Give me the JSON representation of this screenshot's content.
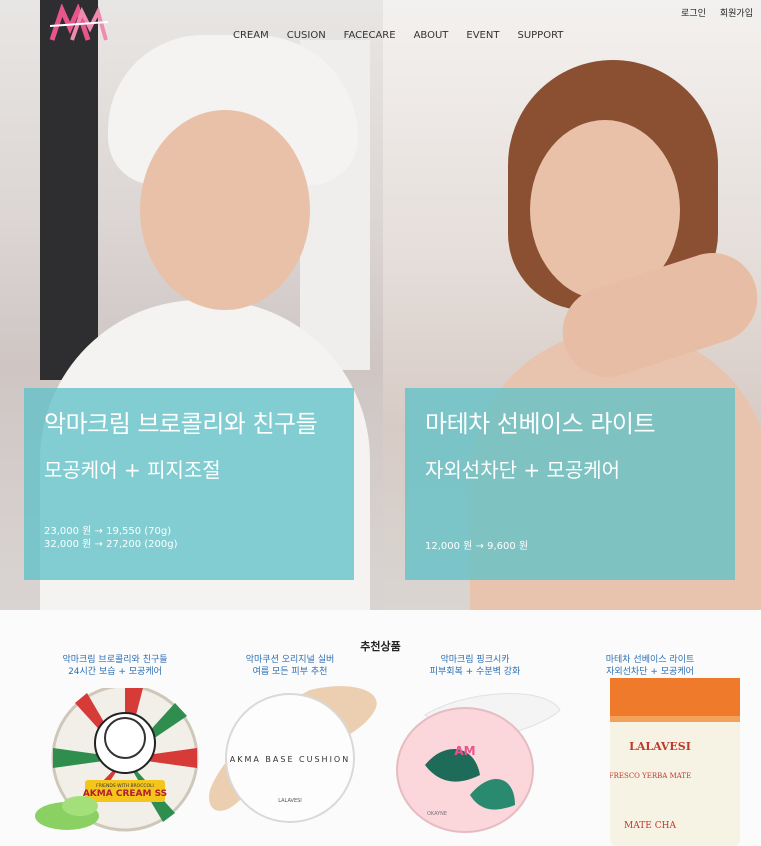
{
  "brand": {
    "logo_text": "AM",
    "accent": "#e8558c",
    "card_color": "#60c2c8"
  },
  "utility_nav": [
    {
      "label": "로그인"
    },
    {
      "label": "회원가입"
    }
  ],
  "main_nav": [
    {
      "label": "CREAM"
    },
    {
      "label": "CUSION"
    },
    {
      "label": "FACECARE"
    },
    {
      "label": "ABOUT"
    },
    {
      "label": "EVENT"
    },
    {
      "label": "SUPPORT"
    }
  ],
  "hero": {
    "left": {
      "title": "악마크림 브로콜리와 친구들",
      "subtitle": "모공케어 + 피지조절",
      "prices": [
        "23,000 원 → 19,550 (70g)",
        "32,000 원 → 27,200 (200g)"
      ]
    },
    "right": {
      "title": "마테차 선베이스 라이트",
      "subtitle": "자외선차단 + 모공케어",
      "prices": [
        "12,000 원 → 9,600 원"
      ]
    }
  },
  "recommend": {
    "title": "추천상품",
    "products": [
      {
        "line1": "악마크림 브로콜리와 친구들",
        "line2": "24시간 보습 + 모공케어",
        "label": "AKMA CREAM SS",
        "tag": "FRIENDS WITH BROCCOLI"
      },
      {
        "line1": "악마쿠션 오리지널 실버",
        "line2": "여름 모든 피부 추천",
        "label": "AKMA BASE CUSHION",
        "brand": "LALAVESI"
      },
      {
        "line1": "악마크림 핑크시카",
        "line2": "피부회복 + 수분벽 강화",
        "label": "AM",
        "brand": "OKAYNE"
      },
      {
        "line1": "마테차 선베이스 라이트",
        "line2": "자외선차단 + 모공케어",
        "label": "LALAVESI",
        "tag": "FRESCO YERBA MATE",
        "tag2": "MATE CHA"
      }
    ]
  }
}
